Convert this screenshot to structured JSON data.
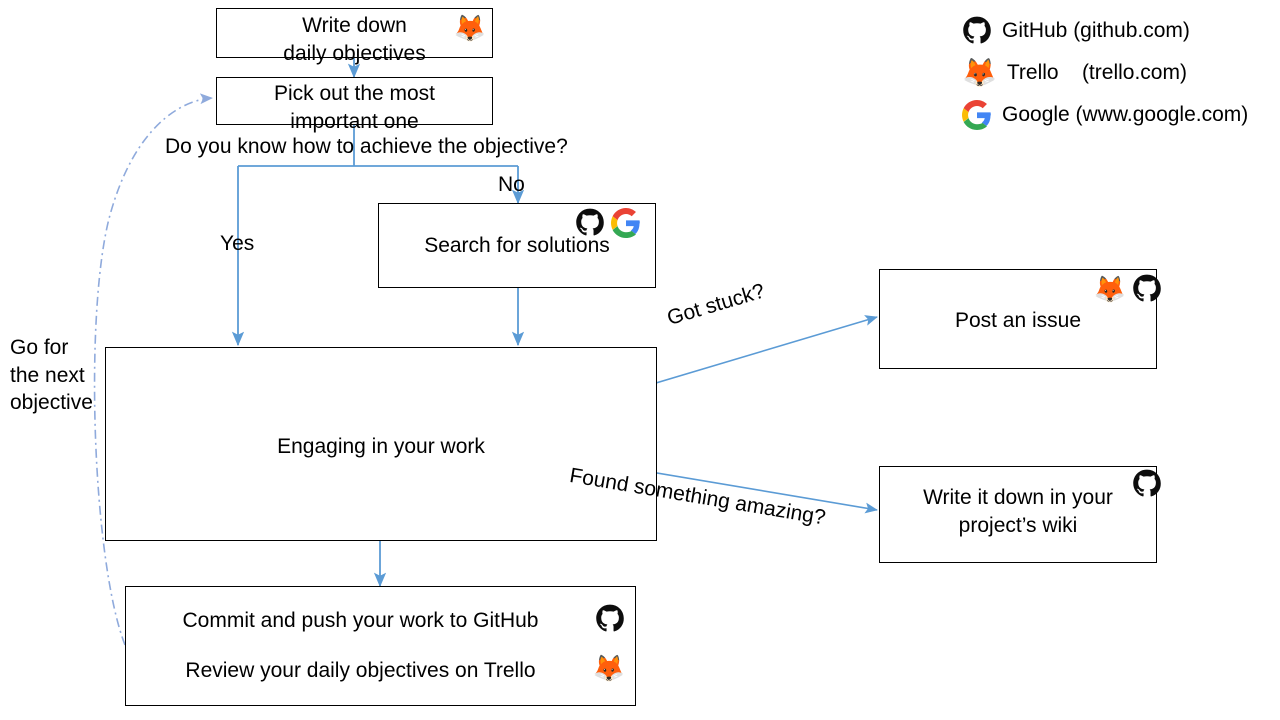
{
  "legend": {
    "items": [
      {
        "icon": "github-icon",
        "label": "GitHub (github.com)"
      },
      {
        "icon": "trello-husky-icon",
        "label": "Trello    (trello.com)"
      },
      {
        "icon": "google-icon",
        "label": "Google (www.google.com)"
      }
    ]
  },
  "nodes": {
    "write_objectives": {
      "text": "Write down\ndaily objectives",
      "icons": [
        "trello-husky-icon"
      ]
    },
    "pick_important": {
      "text": "Pick out the most\nimportant one",
      "icons": []
    },
    "search_solutions": {
      "text": "Search for solutions",
      "icons": [
        "github-icon",
        "google-icon"
      ]
    },
    "engaging_work": {
      "text": "Engaging in your work",
      "icons": []
    },
    "post_issue": {
      "text": "Post an issue",
      "icons": [
        "trello-husky-icon",
        "github-icon"
      ]
    },
    "write_wiki": {
      "text": "Write it down in your\nproject’s wiki",
      "icons": [
        "github-icon"
      ]
    },
    "commit_review": {
      "line1": "Commit and push your work to GitHub",
      "line2": "Review your daily objectives on Trello",
      "icon1": "github-icon",
      "icon2": "trello-husky-icon"
    }
  },
  "edge_labels": {
    "question": "Do you know how to achieve the objective?",
    "yes": "Yes",
    "no": "No",
    "got_stuck": "Got stuck?",
    "found_amazing": "Found something amazing?",
    "go_next": "Go for\nthe next\nobjective"
  },
  "colors": {
    "arrow": "#5b9bd5",
    "feedback_arrow": "#8faadc",
    "box_border": "#000000",
    "text": "#000000",
    "background": "#ffffff"
  }
}
